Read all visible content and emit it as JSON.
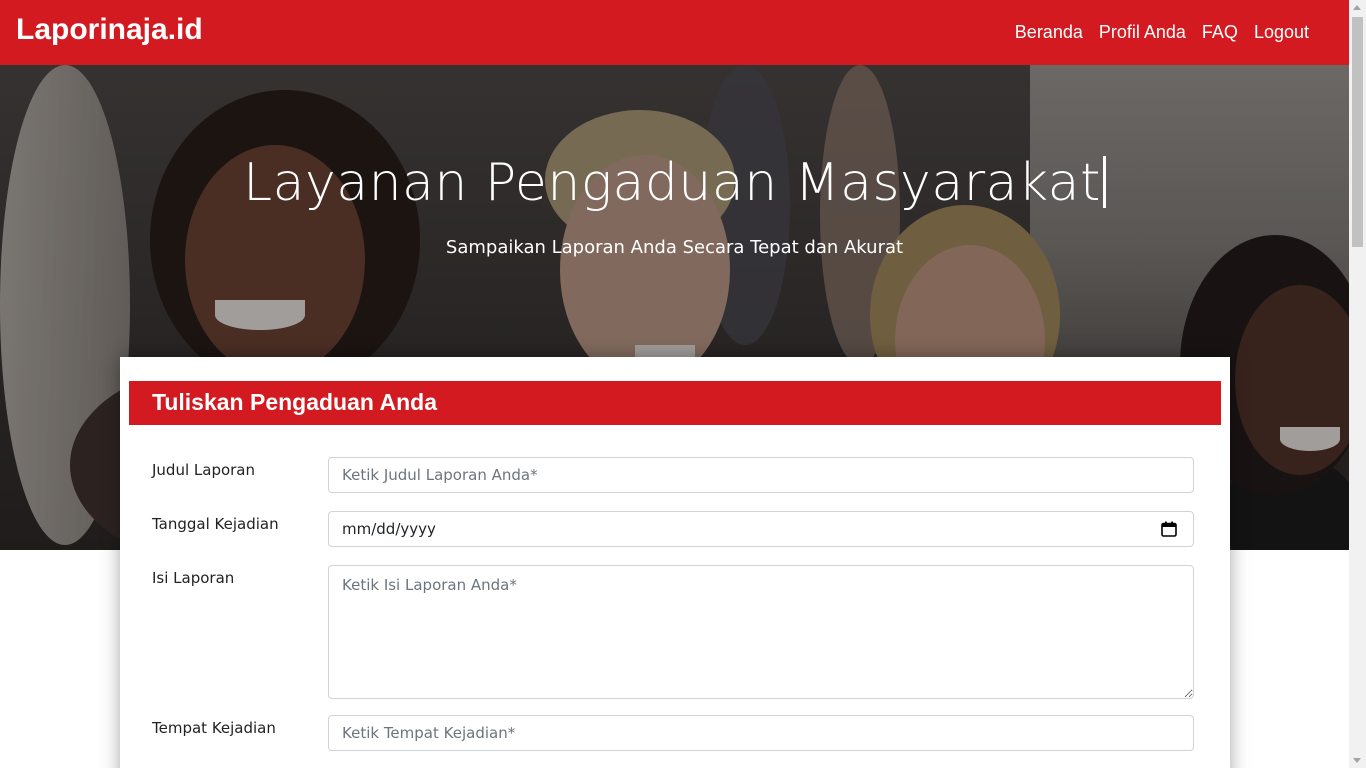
{
  "navbar": {
    "brand": "Laporinaja.id",
    "links": [
      "Beranda",
      "Profil Anda",
      "FAQ",
      "Logout"
    ],
    "background": "#d21a20"
  },
  "hero": {
    "title": "Layanan Pengaduan Masyarakat",
    "subtitle": "Sampaikan Laporan Anda Secara Tepat dan Akurat"
  },
  "form": {
    "header": "Tuliskan Pengaduan Anda",
    "fields": {
      "judul": {
        "label": "Judul Laporan",
        "placeholder": "Ketik Judul Laporan Anda*"
      },
      "tanggal": {
        "label": "Tanggal Kejadian",
        "value": "mm/dd/yyyy",
        "icon": "calendar-icon"
      },
      "isi": {
        "label": "Isi Laporan",
        "placeholder": "Ketik Isi Laporan Anda*"
      },
      "tempat": {
        "label": "Tempat Kejadian",
        "placeholder": "Ketik Tempat Kejadian*"
      }
    }
  }
}
